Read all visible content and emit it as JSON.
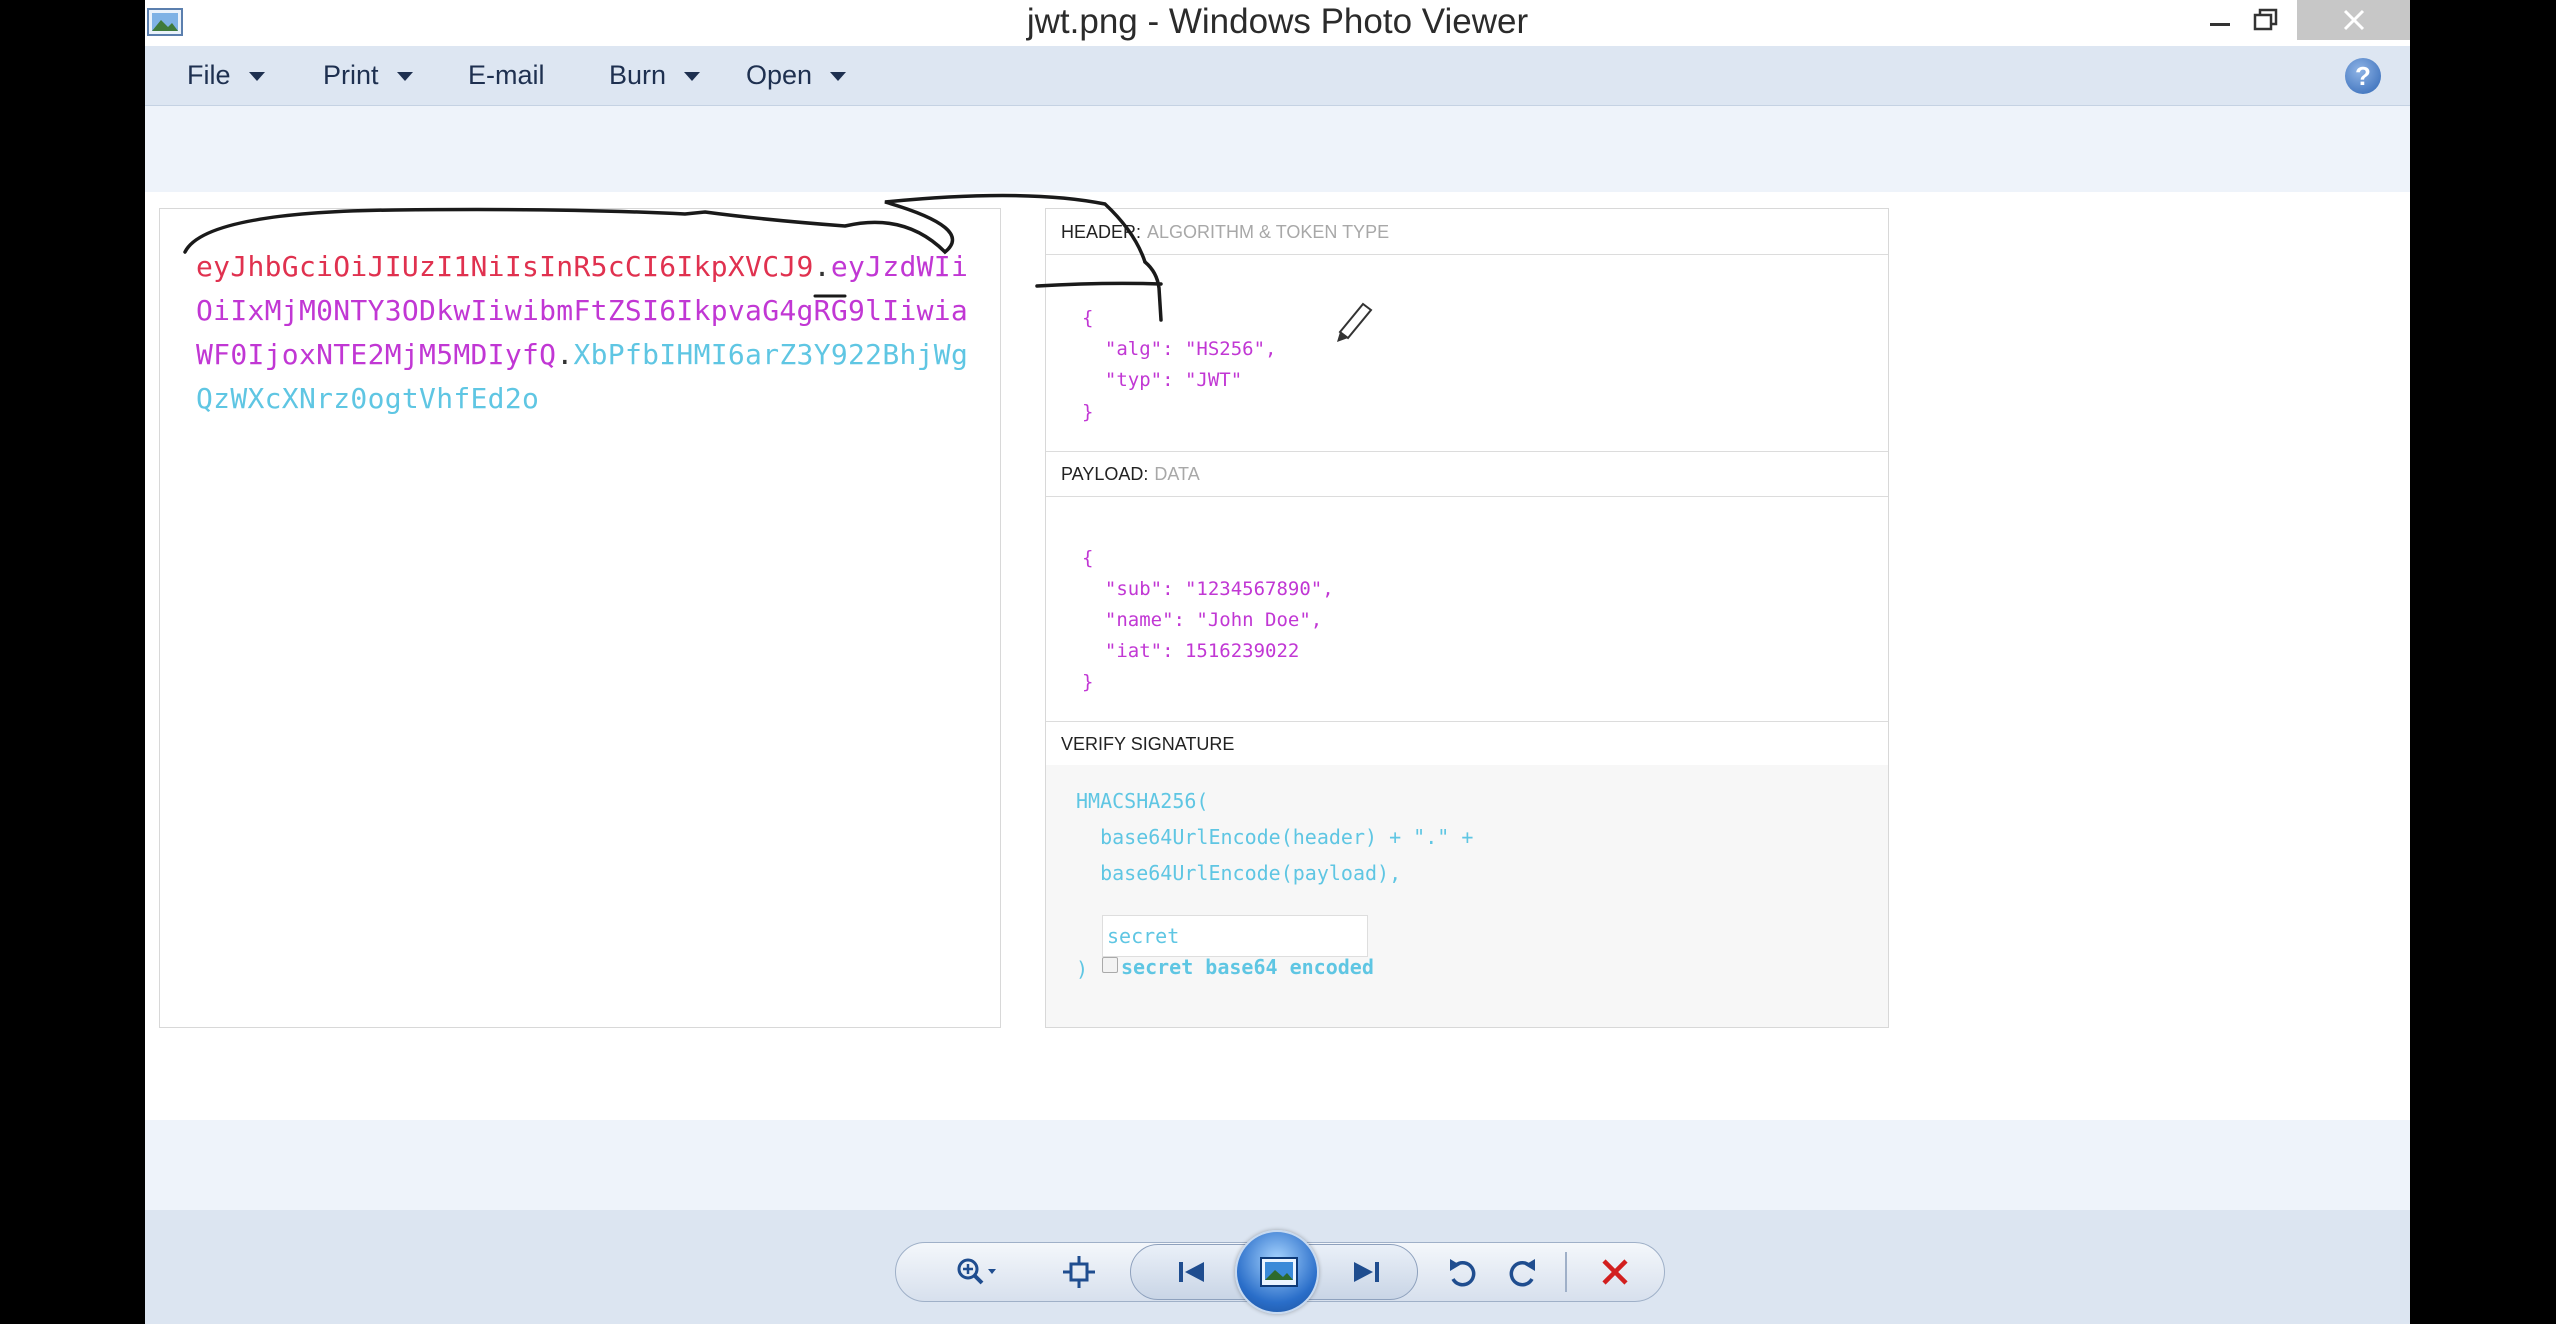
{
  "window": {
    "title": "jwt.png - Windows Photo Viewer"
  },
  "menu": {
    "items": [
      {
        "label": "File",
        "has_arrow": true
      },
      {
        "label": "Print",
        "has_arrow": true
      },
      {
        "label": "E-mail",
        "has_arrow": false
      },
      {
        "label": "Burn",
        "has_arrow": true
      },
      {
        "label": "Open",
        "has_arrow": true
      }
    ],
    "help_glyph": "?"
  },
  "jwt": {
    "encoded": {
      "header_part": "eyJhbGciOiJIUzI1NiIsInR5cCI6IkpXVCJ9",
      "dot1": ".",
      "payload_part": "eyJzdWIiOiIxMjM0NTY3ODkwIiwibmFtZSI6IkpvaG4gRG9lIiwiaWF0IjoxNTE2MjM5MDIyfQ",
      "dot2": ".",
      "signature_part": "XbPfbIHMI6arZ3Y922BhjWgQzWXcXNrz0ogtVhfEd2o"
    },
    "sections": {
      "header_title": "HEADER:",
      "header_sub": "ALGORITHM & TOKEN TYPE",
      "payload_title": "PAYLOAD:",
      "payload_sub": "DATA",
      "verify_title": "VERIFY SIGNATURE"
    },
    "header_json": {
      "open": "{",
      "alg_line": "  \"alg\": \"HS256\",",
      "typ_line": "  \"typ\": \"JWT\"",
      "close": "}"
    },
    "payload_json": {
      "open": "{",
      "sub_line": "  \"sub\": \"1234567890\",",
      "name_line": "  \"name\": \"John Doe\",",
      "iat_line": "  \"iat\": 1516239022",
      "close": "}"
    },
    "verify": {
      "fn_open": "HMACSHA256(",
      "line1": "  base64UrlEncode(header) + \".\" +",
      "line2": "  base64UrlEncode(payload),",
      "secret_value": "secret",
      "close": ")",
      "checkbox_label": "secret base64 encoded"
    }
  },
  "colors": {
    "header": "#e0314f",
    "payload": "#c137d4",
    "signature": "#5fc6e3"
  },
  "toolbar": {
    "icons": [
      "zoom-icon",
      "fit-icon",
      "previous-icon",
      "slideshow-icon",
      "next-icon",
      "rotate-ccw-icon",
      "rotate-cw-icon",
      "delete-icon"
    ]
  }
}
